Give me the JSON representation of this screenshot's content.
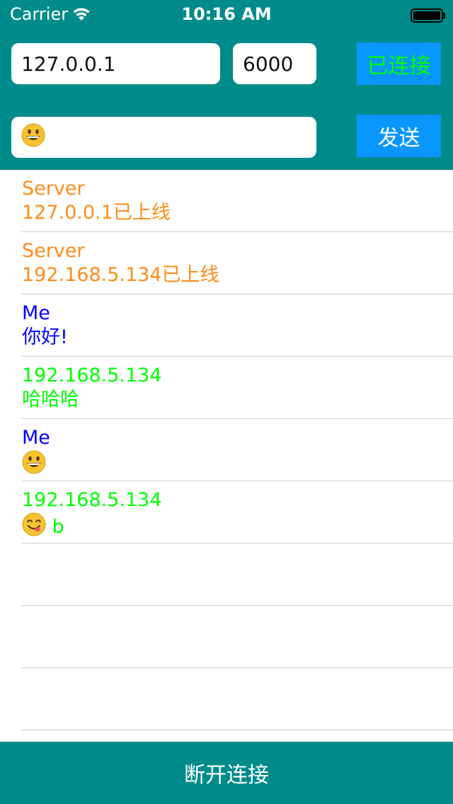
{
  "status_bar": {
    "carrier": "Carrier",
    "time": "10:16 AM"
  },
  "connection": {
    "ip": "127.0.0.1",
    "port": "6000",
    "connect_label": "已连接",
    "connect_label_color": "#00ff00",
    "button_color": "#0a96ff"
  },
  "compose": {
    "message_emoji": "grinning-face-icon",
    "send_label": "发送"
  },
  "messages": [
    {
      "sender": "Server",
      "text": "127.0.0.1已上线",
      "color": "#ff8c1a"
    },
    {
      "sender": "Server",
      "text": "192.168.5.134已上线",
      "color": "#ff8c1a"
    },
    {
      "sender": "Me",
      "text": "你好!",
      "color": "#0000ff"
    },
    {
      "sender": "192.168.5.134",
      "text": "哈哈哈",
      "color": "#00ff00"
    },
    {
      "sender": "Me",
      "emoji": "grinning-face-icon",
      "text": "",
      "color": "#0000ff"
    },
    {
      "sender": "192.168.5.134",
      "emoji": "yum-face-icon",
      "text": "b",
      "color": "#00ff00"
    }
  ],
  "footer": {
    "disconnect_label": "断开连接"
  },
  "colors": {
    "header_bg": "#008b8b",
    "divider": "#cfcfcf"
  }
}
